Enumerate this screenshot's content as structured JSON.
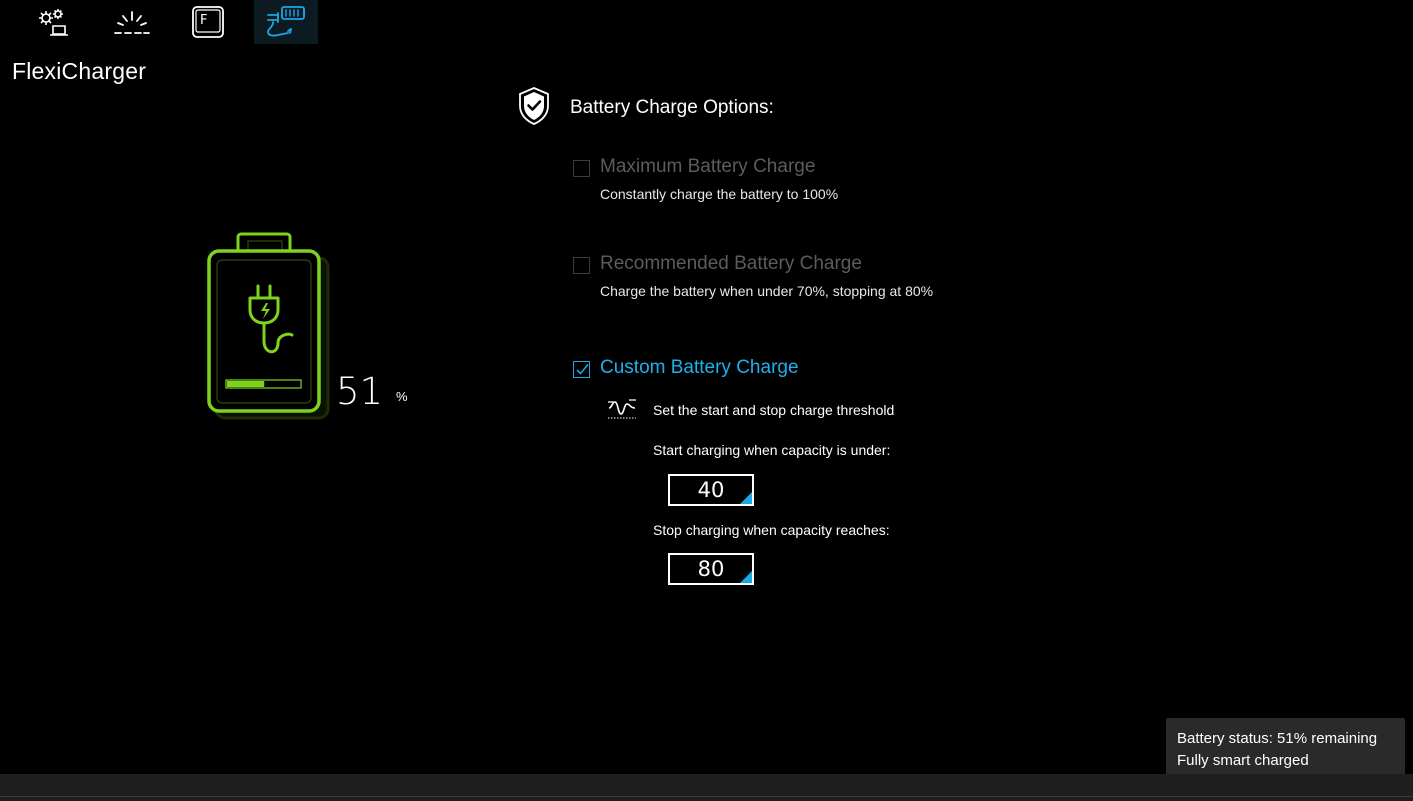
{
  "app": {
    "title": "FlexiCharger"
  },
  "toolbar": {
    "items": [
      {
        "name": "settings",
        "icon": "gear-laptop-icon",
        "active": false
      },
      {
        "name": "lighting",
        "icon": "light-burst-icon",
        "active": false
      },
      {
        "name": "function-key",
        "icon": "f-key-icon",
        "label": "F",
        "active": false
      },
      {
        "name": "flexicharger",
        "icon": "battery-plug-icon",
        "active": true
      }
    ]
  },
  "battery": {
    "percent_value": "51",
    "percent_unit": "%",
    "level_fraction": 0.51,
    "color": "#7ed321"
  },
  "options": {
    "title": "Battery Charge Options:",
    "items": [
      {
        "label": "Maximum Battery Charge",
        "description": "Constantly charge the battery to 100%",
        "checked": false
      },
      {
        "label": "Recommended Battery Charge",
        "description": "Charge the battery when under 70%, stopping at 80%",
        "checked": false
      },
      {
        "label": "Custom Battery Charge",
        "checked": true
      }
    ],
    "custom": {
      "threshold_text": "Set the start and stop charge threshold",
      "start_label": "Start charging when capacity is under:",
      "start_value": "40",
      "stop_label": "Stop charging when capacity reaches:",
      "stop_value": "80"
    }
  },
  "tooltip": {
    "line1": "Battery status: 51% remaining",
    "line2": "Fully smart charged"
  },
  "colors": {
    "accent": "#19a8e6",
    "battery_green": "#7ed321",
    "disabled_text": "#5c5c5c"
  }
}
